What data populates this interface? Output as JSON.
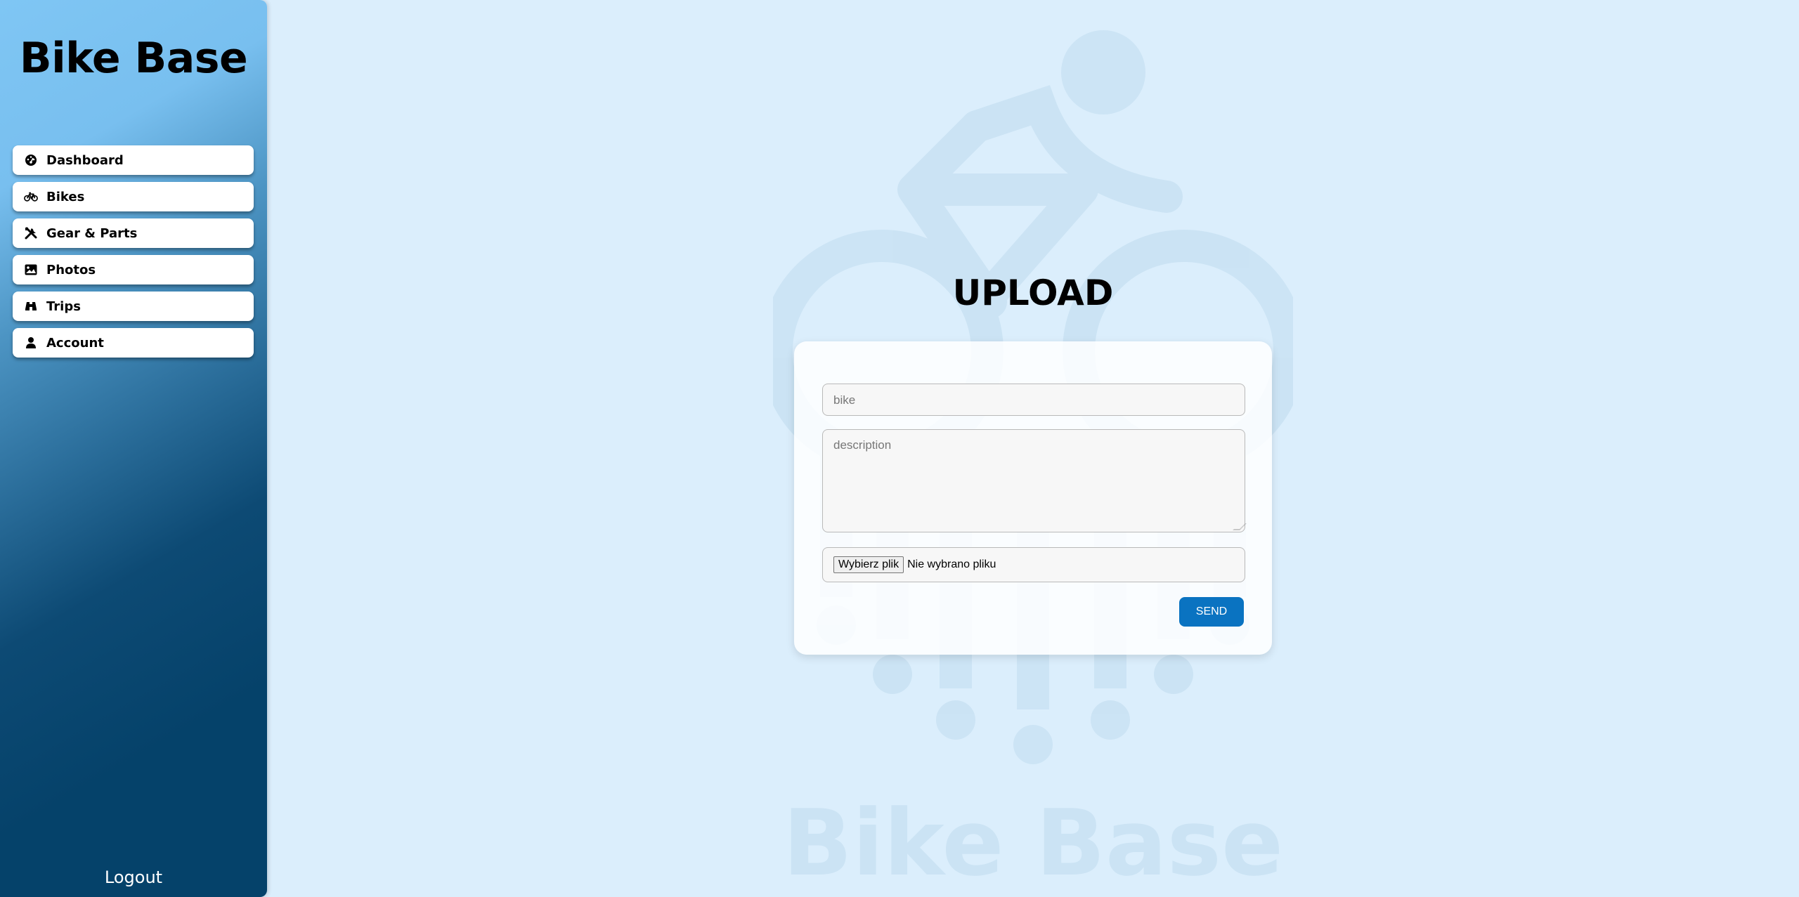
{
  "sidebar": {
    "brand": "Bike Base",
    "items": [
      {
        "label": "Dashboard",
        "icon": "dashboard-gauge-icon"
      },
      {
        "label": "Bikes",
        "icon": "bicycle-icon"
      },
      {
        "label": "Gear & Parts",
        "icon": "tools-icon"
      },
      {
        "label": "Photos",
        "icon": "image-icon"
      },
      {
        "label": "Trips",
        "icon": "binoculars-icon"
      },
      {
        "label": "Account",
        "icon": "user-icon"
      }
    ],
    "logout": "Logout"
  },
  "main": {
    "title": "UPLOAD",
    "watermark_text": "Bike Base",
    "form": {
      "bike_placeholder": "bike",
      "description_placeholder": "description",
      "file_button": "Wybierz plik",
      "file_status": "Nie wybrano pliku",
      "send_label": "SEND"
    }
  },
  "colors": {
    "background": "#dbeefc",
    "sidebar_top": "#7fc6f4",
    "sidebar_bottom": "#05426a",
    "send_button": "#0a73c1",
    "watermark": "#c9e2f3"
  }
}
